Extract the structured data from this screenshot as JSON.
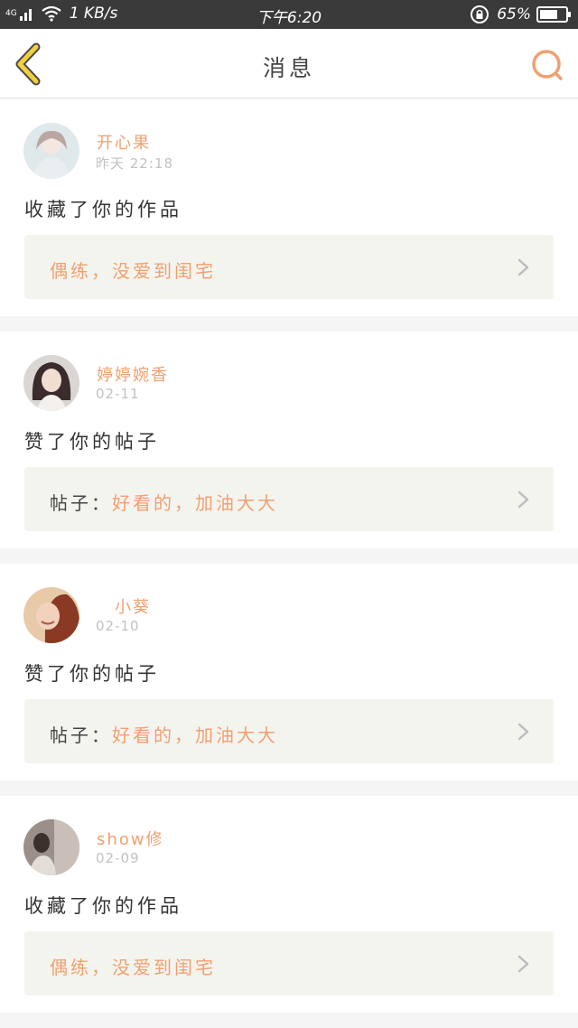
{
  "status_bar": {
    "network": "4G",
    "speed": "1 KB/s",
    "time": "下午6:20",
    "battery": "65%"
  },
  "header": {
    "title": "消息",
    "back_icon": "chevron-left-icon",
    "search_icon": "search-icon"
  },
  "colors": {
    "accent": "#f0a070",
    "back_icon": "#f0d040",
    "search_icon": "#f0a070",
    "ref_bg": "#f4f4ef"
  },
  "messages": [
    {
      "username": "开心果",
      "time": "昨天 22:18",
      "action": "收藏了你的作品",
      "ref_prefix": "",
      "ref_text": "偶练，没爱到闺宅"
    },
    {
      "username": "婷婷婉香",
      "time": "02-11",
      "action": "赞了你的帖子",
      "ref_prefix": "帖子：",
      "ref_text": "好看的，加油大大"
    },
    {
      "username": "小葵",
      "time": "02-10",
      "action": "赞了你的帖子",
      "ref_prefix": "帖子：",
      "ref_text": "好看的，加油大大"
    },
    {
      "username": "show修",
      "time": "02-09",
      "action": "收藏了你的作品",
      "ref_prefix": "",
      "ref_text": "偶练，没爱到闺宅"
    }
  ]
}
